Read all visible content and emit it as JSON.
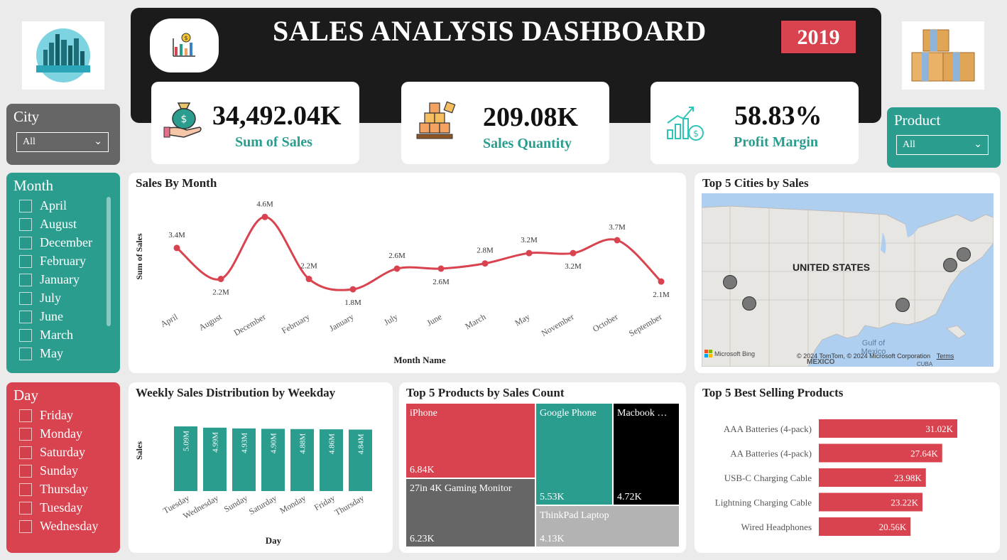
{
  "header": {
    "title": "SALES ANALYSIS DASHBOARD",
    "year": "2019"
  },
  "kpis": [
    {
      "value": "34,492.04K",
      "label": "Sum of Sales",
      "icon": "money-bag-hand-icon"
    },
    {
      "value": "209.08K",
      "label": "Sales Quantity",
      "icon": "boxes-pallet-icon"
    },
    {
      "value": "58.83%",
      "label": "Profit Margin",
      "icon": "growth-chart-coin-icon"
    }
  ],
  "slicers": {
    "city": {
      "title": "City",
      "selected": "All"
    },
    "product": {
      "title": "Product",
      "selected": "All"
    },
    "month": {
      "title": "Month",
      "items": [
        "April",
        "August",
        "December",
        "February",
        "January",
        "July",
        "June",
        "March",
        "May"
      ]
    },
    "day": {
      "title": "Day",
      "items": [
        "Friday",
        "Monday",
        "Saturday",
        "Sunday",
        "Thursday",
        "Tuesday",
        "Wednesday"
      ]
    }
  },
  "colors": {
    "accent_red": "#d9434f",
    "teal": "#2a9d8f",
    "dark": "#1b1b1b",
    "gray": "#666666"
  },
  "sales_by_month": {
    "title": "Sales By Month",
    "ylabel": "Sum of Sales",
    "xlabel": "Month Name"
  },
  "weekday_chart": {
    "title": "Weekly Sales Distribution by Weekday",
    "ylabel": "Sales",
    "xlabel": "Day"
  },
  "map": {
    "title": "Top 5 Cities by Sales",
    "country_label": "UNITED STATES",
    "gulf_label": "Gulf of Mexico",
    "mexico_label": "MEXICO",
    "cuba_label": "CUBA",
    "attribution": "© 2024 TomTom, © 2024 Microsoft Corporation",
    "terms": "Terms",
    "brand": "Microsoft Bing"
  },
  "treemap": {
    "title": "Top 5 Products by Sales Count",
    "items": [
      {
        "name": "iPhone",
        "value": "6.84K",
        "color": "#d9434f"
      },
      {
        "name": "Google Phone",
        "value": "5.53K",
        "color": "#2a9d8f"
      },
      {
        "name": "Macbook …",
        "value": "4.72K",
        "color": "#000000"
      },
      {
        "name": "27in 4K Gaming Monitor",
        "value": "6.23K",
        "color": "#666666"
      },
      {
        "name": "ThinkPad Laptop",
        "value": "4.13K",
        "color": "#b3b3b3"
      }
    ]
  },
  "best_selling": {
    "title": "Top 5 Best Selling Products"
  },
  "chart_data": [
    {
      "type": "line",
      "title": "Sales By Month",
      "xlabel": "Month Name",
      "ylabel": "Sum of Sales",
      "categories": [
        "April",
        "August",
        "December",
        "February",
        "January",
        "July",
        "June",
        "March",
        "May",
        "November",
        "October",
        "September"
      ],
      "values": [
        3.4,
        2.2,
        4.6,
        2.2,
        1.8,
        2.6,
        2.6,
        2.8,
        3.2,
        3.2,
        3.7,
        2.1
      ],
      "labels": [
        "3.4M",
        "2.2M",
        "4.6M",
        "2.2M",
        "1.8M",
        "2.6M",
        "2.6M",
        "2.8M",
        "3.2M",
        "3.2M",
        "3.7M",
        "2.1M"
      ],
      "color": "#d9434f"
    },
    {
      "type": "bar",
      "title": "Weekly Sales Distribution by Weekday",
      "xlabel": "Day",
      "ylabel": "Sales",
      "categories": [
        "Tuesday",
        "Wednesday",
        "Sunday",
        "Saturday",
        "Monday",
        "Friday",
        "Thursday"
      ],
      "values": [
        5.09,
        4.99,
        4.93,
        4.9,
        4.88,
        4.86,
        4.84
      ],
      "labels": [
        "5.09M",
        "4.99M",
        "4.93M",
        "4.90M",
        "4.88M",
        "4.86M",
        "4.84M"
      ],
      "color": "#2a9d8f"
    },
    {
      "type": "bar",
      "orientation": "horizontal",
      "title": "Top 5 Best Selling Products",
      "categories": [
        "AAA Batteries (4-pack)",
        "AA Batteries (4-pack)",
        "USB-C Charging Cable",
        "Lightning Charging Cable",
        "Wired Headphones"
      ],
      "values": [
        31.02,
        27.64,
        23.98,
        23.22,
        20.56
      ],
      "labels": [
        "31.02K",
        "27.64K",
        "23.98K",
        "23.22K",
        "20.56K"
      ],
      "color": "#d9434f"
    }
  ]
}
